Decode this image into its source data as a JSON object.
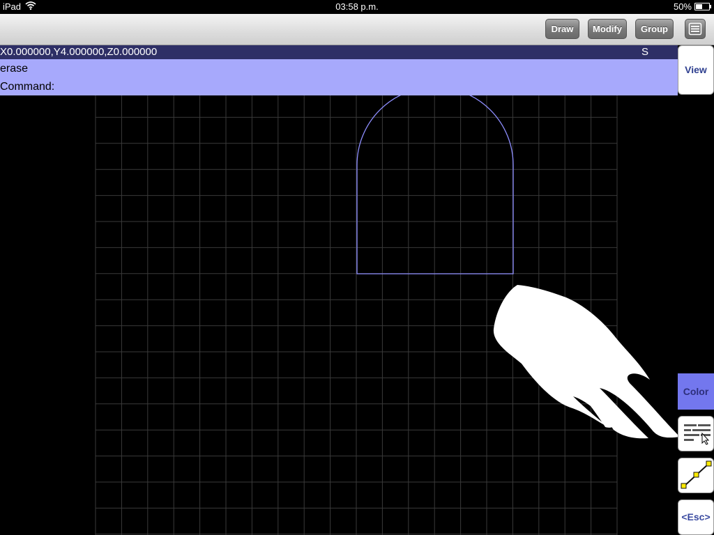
{
  "status_bar": {
    "device": "iPad",
    "time": "03:58 p.m.",
    "battery": "50%",
    "battery_level": 0.5
  },
  "toolbar": {
    "draw_label": "Draw",
    "modify_label": "Modify",
    "group_label": "Group",
    "menu_icon": "list-icon"
  },
  "command": {
    "coordinates": "X0.000000,Y4.000000,Z0.000000",
    "snap_indicator": "S",
    "history_line": "erase",
    "prompt": "Command:"
  },
  "side_buttons": {
    "view_label": "View",
    "color_label": "Color",
    "layers_icon": "layers-icon",
    "line_icon": "line-segment-icon",
    "esc_label": "<Esc>"
  },
  "colors": {
    "coord_bar": "#2e2f66",
    "command_bg": "#a7a9fc",
    "color_button": "#7377ee",
    "drawn_shape": "#8e8eff",
    "grid": "#3a3a3a"
  }
}
